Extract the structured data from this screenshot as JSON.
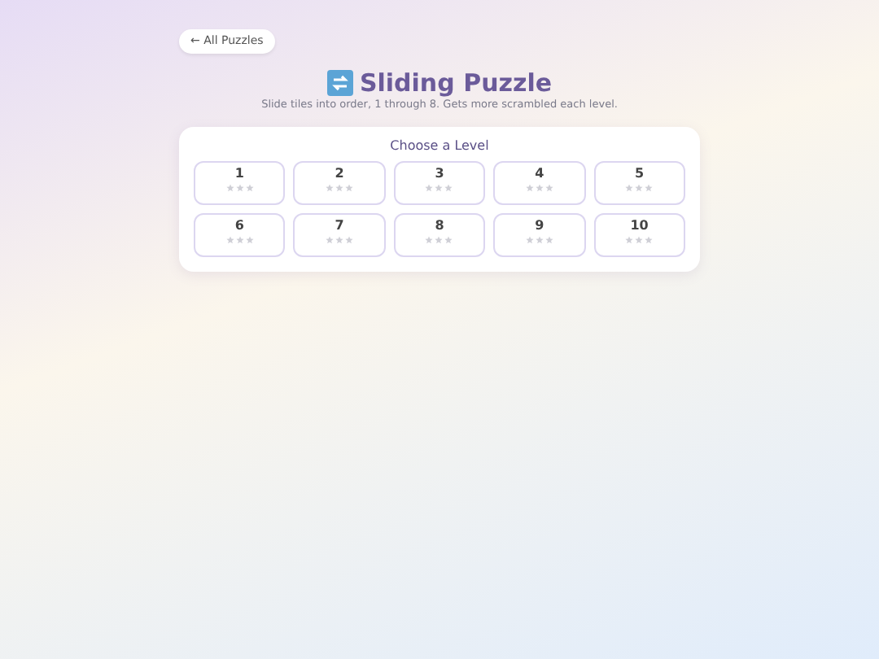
{
  "back_link": "← All Puzzles",
  "title": "Sliding Puzzle",
  "subtitle": "Slide tiles into order, 1 through 8. Gets more scrambled each level.",
  "panel": {
    "heading": "Choose a Level",
    "levels": [
      {
        "label": "1",
        "stars": 0
      },
      {
        "label": "2",
        "stars": 0
      },
      {
        "label": "3",
        "stars": 0
      },
      {
        "label": "4",
        "stars": 0
      },
      {
        "label": "5",
        "stars": 0
      },
      {
        "label": "6",
        "stars": 0
      },
      {
        "label": "7",
        "stars": 0
      },
      {
        "label": "8",
        "stars": 0
      },
      {
        "label": "9",
        "stars": 0
      },
      {
        "label": "10",
        "stars": 0
      }
    ]
  }
}
